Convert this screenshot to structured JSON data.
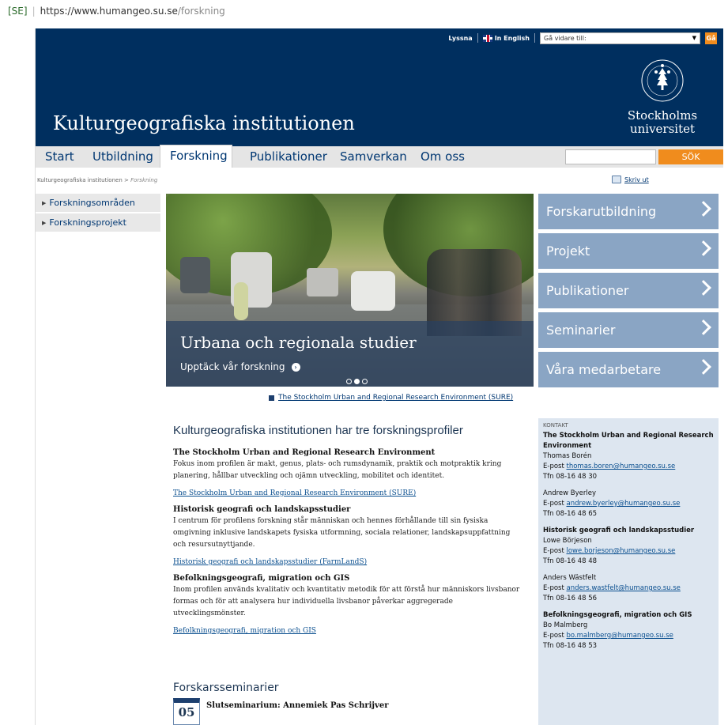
{
  "address_bar": {
    "tag": "[SE]",
    "host": "https://www.humangeo.su.se",
    "path": "/forskning"
  },
  "topbar": {
    "listen": "Lyssna",
    "english": "In English",
    "goto_placeholder": "Gå vidare till:",
    "go": "Gå"
  },
  "header": {
    "dept_title": "Kulturgeografiska institutionen",
    "uni_line1": "Stockholms",
    "uni_line2": "universitet"
  },
  "nav": {
    "items": [
      "Start",
      "Utbildning",
      "Forskning",
      "Publikationer",
      "Samverkan",
      "Om oss"
    ],
    "active": "Forskning",
    "search_button": "SÖK"
  },
  "breadcrumb": {
    "root": "Kulturgeografiska institutionen",
    "sep": ">",
    "current": "Forskning"
  },
  "print": "Skriv ut",
  "sidenav": [
    "Forskningsområden",
    "Forskningsprojekt"
  ],
  "hero": {
    "title": "Urbana och regionala studier",
    "link": "Upptäck vår forskning"
  },
  "tiles": [
    "Forskarutbildning",
    "Projekt",
    "Publikationer",
    "Seminarier",
    "Våra medarbetare"
  ],
  "sure_link": "The Stockholm Urban and Regional Research Environment (SURE)",
  "main": {
    "heading": "Kulturgeografiska institutionen har tre forskningsprofiler",
    "profiles": [
      {
        "title": "The Stockholm Urban and Regional Research Environment",
        "text": "Fokus inom profilen är makt, genus, plats- och rumsdynamik, praktik och motpraktik kring planering, hållbar utveckling och ojämn utveckling, mobilitet och identitet.",
        "link": "The Stockholm Urban and Regional Research Environment (SURE)"
      },
      {
        "title": "Historisk geografi och landskapsstudier",
        "text": "I centrum för profilens forskning står människan och hennes förhållande till sin fysiska omgivning inklusive landskapets fysiska utformning, sociala relationer, landskapsuppfattning och resursutnyttjande.",
        "link": "Historisk geografi och landskapsstudier (FarmLandS)"
      },
      {
        "title": "Befolkningsgeografi, migration och GIS",
        "text": "Inom profilen används kvalitativ och kvantitativ metodik för att förstå hur människors livsbanor formas och för att analysera hur individuella livsbanor påverkar aggregerade utvecklingsmönster.",
        "link": "Befolkningsgeografi, migration och GIS"
      }
    ]
  },
  "seminars": {
    "heading": "Forskarsseminarier",
    "date": "05",
    "title": "Slutseminarium: Annemiek Pas Schrijver"
  },
  "kontakt": {
    "label": "KONTAKT",
    "g1_title": "The Stockholm Urban and Regional Research Environment",
    "p1_name": "Thomas Borén",
    "p1_mail": "thomas.boren@humangeo.su.se",
    "p1_tel": "Tfn 08-16 48 30",
    "p2_name": "Andrew Byerley",
    "p2_mail": "andrew.byerley@humangeo.su.se",
    "p2_tel": "Tfn 08-16 48 65",
    "g2_title": "Historisk geografi och landskapsstudier",
    "p3_name": "Lowe Börjeson",
    "p3_mail": "lowe.borjeson@humangeo.su.se",
    "p3_tel": "Tfn 08-16 48 48",
    "p4_name": "Anders Wästfelt",
    "p4_mail": "anders.wastfelt@humangeo.su.se",
    "p4_tel": "Tfn 08-16 48 56",
    "g3_title": "Befolkningsgeografi, migration och GIS",
    "p5_name": "Bo Malmberg",
    "p5_mail": "bo.malmberg@humangeo.su.se",
    "p5_tel": "Tfn 08-16 48 53",
    "mail_prefix": "E-post"
  }
}
